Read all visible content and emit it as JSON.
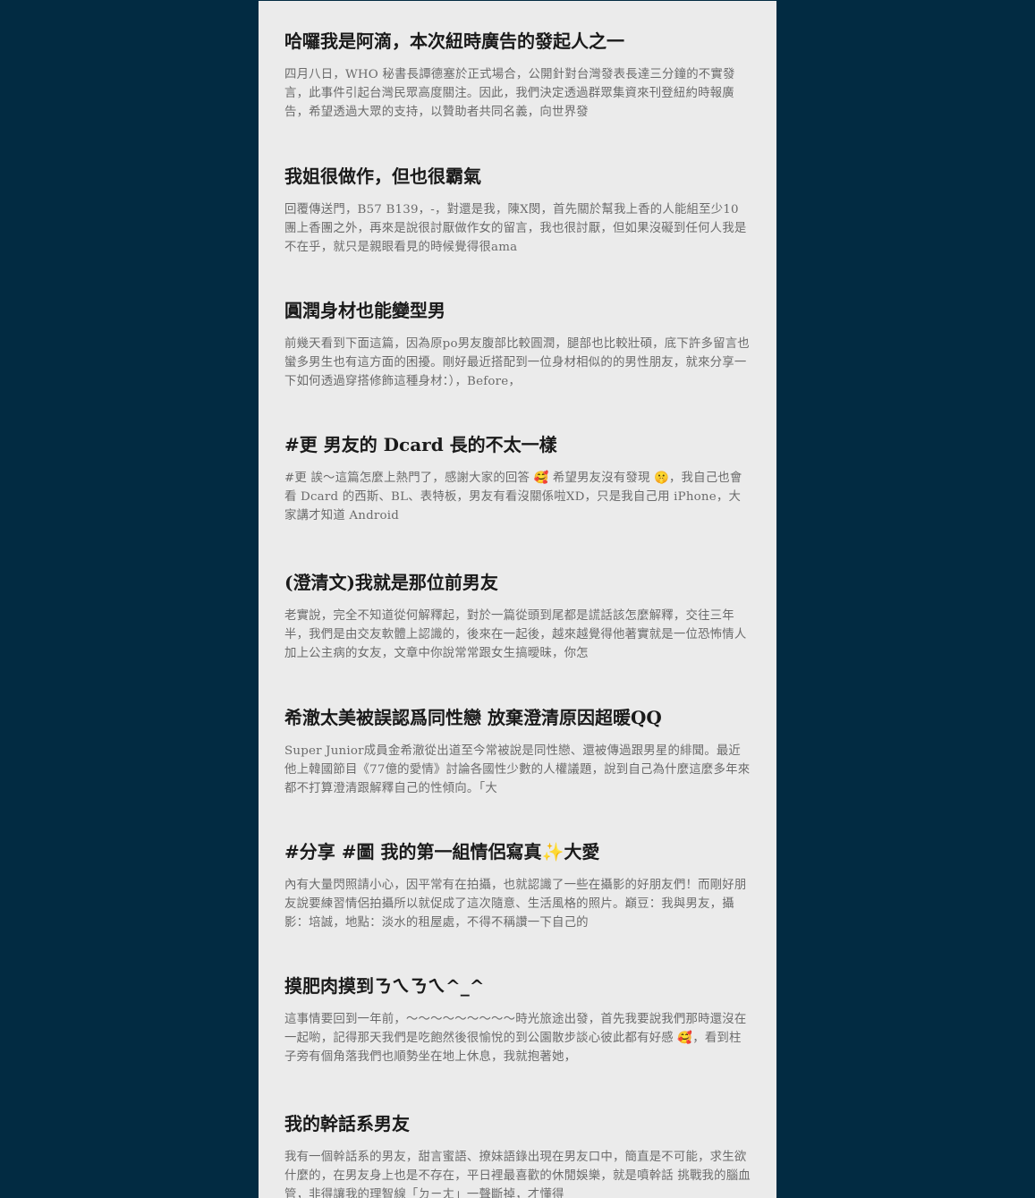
{
  "posts": [
    {
      "title": "哈囉我是阿滴，本次紐時廣告的發起人之一",
      "excerpt": "四月八日，WHO 秘書長譚德塞於正式場合，公開針對台灣發表長達三分鐘的不實發言，此事件引起台灣民眾高度關注。因此，我們決定透過群眾集資來刊登紐約時報廣告，希望透過大眾的支持，以贊助者共同名義，向世界發"
    },
    {
      "title": "我姐很做作，但也很霸氣",
      "excerpt": "回覆傳送門，B57 B139，-，對還是我，陳X閔，首先關於幫我上香的人能組至少10團上香團之外，再來是說很討厭做作女的留言，我也很討厭，但如果沒礙到任何人我是不在乎，就只是親眼看見的時候覺得很ama"
    },
    {
      "title": "圓潤身材也能變型男",
      "excerpt": "前幾天看到下面這篇，因為原po男友腹部比較圓潤，腿部也比較壯碩，底下許多留言也蠻多男生也有這方面的困擾。剛好最近搭配到一位身材相似的的男性朋友，就來分享一下如何透過穿搭修飾這種身材：），Before，"
    },
    {
      "title": "#更 男友的 Dcard 長的不太一樣",
      "excerpt": "#更 誒～這篇怎麼上熱門了，感謝大家的回答 🥰 希望男友沒有發現 🤫，我自己也會看 Dcard 的西斯、BL、表特板，男友有看沒關係啦XD，只是我自己用 iPhone，大家講才知道 Android"
    },
    {
      "title": "(澄清文)我就是那位前男友",
      "excerpt": "老實說，完全不知道從何解釋起，對於一篇從頭到尾都是謊話該怎麼解釋，交往三年半，我們是由交友軟體上認識的，後來在一起後，越來越覺得他著實就是一位恐怖情人加上公主病的女友，文章中你說常常跟女生搞曖昧，你怎"
    },
    {
      "title": "希澈太美被誤認爲同性戀 放棄澄清原因超暖QQ",
      "excerpt": "Super Junior成員金希澈從出道至今常被說是同性戀、還被傳過跟男星的緋聞。最近他上韓國節目《77億的愛情》討論各國性少數的人權議題，說到自己為什麼這麼多年來都不打算澄清跟解釋自己的性傾向。「大"
    },
    {
      "title": "#分享 #圖 我的第一組情侶寫真✨大愛",
      "excerpt": "內有大量閃照請小心，因平常有在拍攝，也就認識了一些在攝影的好朋友們！而剛好朋友說要練習情侶拍攝所以就促成了這次隨意、生活風格的照片。巔豆：我與男友，攝影：培誠，地點：淡水的租屋處，不得不稱讚一下自己的"
    },
    {
      "title": "摸肥肉摸到ㄋㄟㄋㄟ^_^",
      "excerpt": "這事情要回到一年前，～～～～～～～～～時光旅途出發，首先我要說我們那時還沒在一起喲，記得那天我們是吃飽然後很愉悅的到公園散步談心彼此都有好感 🥰，看到柱子旁有個角落我們也順勢坐在地上休息，我就抱著她，"
    },
    {
      "title": "我的幹話系男友",
      "excerpt": "我有一個幹話系的男友，甜言蜜語、撩妹語錄出現在男友口中，簡直是不可能，求生欲什麼的，在男友身上也是不存在，平日裡最喜歡的休閒娛樂，就是噴幹話 挑戰我的腦血管，非得讓我的理智線「ㄉㄧㄤ」一聲斷掉，才懂得"
    }
  ]
}
